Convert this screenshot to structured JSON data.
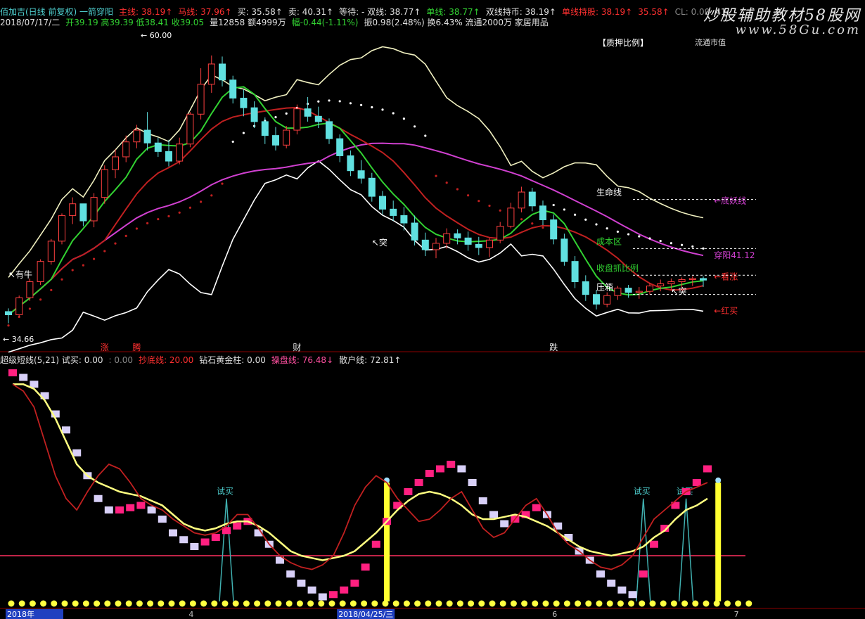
{
  "header": {
    "row1": [
      {
        "t": "佰加吉(日线 前复权) 一箭穿阳",
        "c": "cyan"
      },
      {
        "t": "主线: 38.19↑",
        "c": "red"
      },
      {
        "t": "马线: 37.96↑",
        "c": "red"
      },
      {
        "t": "买: 35.58↑",
        "c": "white"
      },
      {
        "t": "卖: 40.31↑",
        "c": "white"
      },
      {
        "t": "等待: - 双线: 38.77↑",
        "c": "white"
      },
      {
        "t": "单线: 38.77↑",
        "c": "green"
      },
      {
        "t": "双线持币: 38.19↑",
        "c": "white"
      },
      {
        "t": "单线持股: 38.19↑",
        "c": "red"
      },
      {
        "t": "35.58↑",
        "c": "red"
      },
      {
        "t": "CL: 0.00",
        "c": "gray"
      },
      {
        "t": "41.",
        "c": "white"
      }
    ],
    "row2": [
      {
        "t": "2018/07/17/二",
        "c": "white"
      },
      {
        "t": "开39.19 高39.39 低38.41 收39.05",
        "c": "green"
      },
      {
        "t": "量12858 额4999万",
        "c": "white"
      },
      {
        "t": "幅-0.44(-1.11%)",
        "c": "green"
      },
      {
        "t": "振0.98(2.48%) 换6.43% 流通2000万 家居用品",
        "c": "white"
      }
    ],
    "row3": [
      {
        "t": "超级短线(5,21) 试买: 0.00",
        "c": "white"
      },
      {
        "t": ": 0.00",
        "c": "gray"
      },
      {
        "t": "抄底线: 20.00",
        "c": "red"
      },
      {
        "t": "钻石黄金柱: 0.00",
        "c": "white"
      },
      {
        "t": "操盘线: 76.48↓",
        "c": "pink"
      },
      {
        "t": "散户线: 72.81↑",
        "c": "white"
      }
    ],
    "tab_label": "【质押比例】",
    "watermark1": "炒股辅助教材58股网",
    "watermark2": "www.58Gu.com",
    "top_right_text": "流通市值"
  },
  "chart_data": [
    {
      "type": "candlestick",
      "title": "佰加吉(日线 前复权) 一箭穿阳",
      "ylim": [
        33,
        62
      ],
      "x_count": 66,
      "candles": [
        [
          36.1,
          36.4,
          35.0,
          35.8
        ],
        [
          35.8,
          37.6,
          35.6,
          37.4
        ],
        [
          37.4,
          39.2,
          37.1,
          38.9
        ],
        [
          38.9,
          41.0,
          38.6,
          40.8
        ],
        [
          40.8,
          42.9,
          40.5,
          42.7
        ],
        [
          42.7,
          45.3,
          42.4,
          45.1
        ],
        [
          45.1,
          46.8,
          44.3,
          46.2
        ],
        [
          46.2,
          45.9,
          44.1,
          44.6
        ],
        [
          44.6,
          47.2,
          44.0,
          46.8
        ],
        [
          46.8,
          49.8,
          46.2,
          49.4
        ],
        [
          49.4,
          51.3,
          48.6,
          50.6
        ],
        [
          50.6,
          52.6,
          50.1,
          52.0
        ],
        [
          52.0,
          53.6,
          51.4,
          53.1
        ],
        [
          53.1,
          54.8,
          51.2,
          51.9
        ],
        [
          51.9,
          52.4,
          50.6,
          51.1
        ],
        [
          51.1,
          52.2,
          49.7,
          50.2
        ],
        [
          50.2,
          52.4,
          49.9,
          51.8
        ],
        [
          51.8,
          54.8,
          51.5,
          54.6
        ],
        [
          54.6,
          58.9,
          54.1,
          57.4
        ],
        [
          57.4,
          60.1,
          56.6,
          59.3
        ],
        [
          59.3,
          60.0,
          57.2,
          57.8
        ],
        [
          57.8,
          58.2,
          55.6,
          56.1
        ],
        [
          56.1,
          56.9,
          54.4,
          55.2
        ],
        [
          55.2,
          55.8,
          53.3,
          53.9
        ],
        [
          53.9,
          54.3,
          51.8,
          52.6
        ],
        [
          52.6,
          53.4,
          51.2,
          51.7
        ],
        [
          51.7,
          53.5,
          51.4,
          53.1
        ],
        [
          53.1,
          55.5,
          52.7,
          55.1
        ],
        [
          55.1,
          56.2,
          53.9,
          54.4
        ],
        [
          54.4,
          55.3,
          53.3,
          53.9
        ],
        [
          53.9,
          54.2,
          51.8,
          52.3
        ],
        [
          52.3,
          52.7,
          50.1,
          50.7
        ],
        [
          50.7,
          51.2,
          48.8,
          49.3
        ],
        [
          49.3,
          50.3,
          48.1,
          48.6
        ],
        [
          48.6,
          49.1,
          46.4,
          46.9
        ],
        [
          46.9,
          47.4,
          45.2,
          45.7
        ],
        [
          45.7,
          46.5,
          44.6,
          45.1
        ],
        [
          45.1,
          45.9,
          43.7,
          44.4
        ],
        [
          44.4,
          45.1,
          42.3,
          42.8
        ],
        [
          42.8,
          43.5,
          41.3,
          41.9
        ],
        [
          41.9,
          43.0,
          41.1,
          42.5
        ],
        [
          42.5,
          43.9,
          42.0,
          43.4
        ],
        [
          43.4,
          43.8,
          42.4,
          43.0
        ],
        [
          43.0,
          43.6,
          41.8,
          42.4
        ],
        [
          42.4,
          43.1,
          41.4,
          42.1
        ],
        [
          42.1,
          43.0,
          41.2,
          42.8
        ],
        [
          42.8,
          44.5,
          42.5,
          44.1
        ],
        [
          44.1,
          46.3,
          43.9,
          45.8
        ],
        [
          45.8,
          47.8,
          45.4,
          47.3
        ],
        [
          47.3,
          47.7,
          45.5,
          46.0
        ],
        [
          46.0,
          46.5,
          44.2,
          44.7
        ],
        [
          44.7,
          45.2,
          42.4,
          42.9
        ],
        [
          42.9,
          43.4,
          40.4,
          40.8
        ],
        [
          40.8,
          41.3,
          38.3,
          38.9
        ],
        [
          38.9,
          39.5,
          37.1,
          37.7
        ],
        [
          37.7,
          38.1,
          36.3,
          36.8
        ],
        [
          36.8,
          37.9,
          36.5,
          37.6
        ],
        [
          37.6,
          38.5,
          37.2,
          38.3
        ],
        [
          38.3,
          38.6,
          37.4,
          37.9
        ],
        [
          37.9,
          38.4,
          37.3,
          38.0
        ],
        [
          38.0,
          38.8,
          37.7,
          38.5
        ],
        [
          38.5,
          39.1,
          38.0,
          38.7
        ],
        [
          38.7,
          39.2,
          38.1,
          38.9
        ],
        [
          38.9,
          39.3,
          38.3,
          39.1
        ],
        [
          39.1,
          39.4,
          38.5,
          39.2
        ],
        [
          39.2,
          39.39,
          38.41,
          39.05
        ]
      ],
      "price_labels": {
        "high": "60.00",
        "low": "34.66"
      },
      "annotations": [
        {
          "label": "生命线",
          "color": "#ffffff",
          "i": 55,
          "y": 47.0
        },
        {
          "label": "成本区",
          "color": "#32d232",
          "i": 55,
          "y": 42.4
        },
        {
          "label": "收盘抓比例",
          "color": "#32d232",
          "i": 55,
          "y": 39.9
        },
        {
          "label": "压箱",
          "color": "#ffffff",
          "i": 55,
          "y": 38.1
        },
        {
          "label": "↖突",
          "color": "#ffffff",
          "i": 34,
          "y": 42.3
        },
        {
          "label": "↖突",
          "color": "#ffffff",
          "i": 62,
          "y": 37.7
        },
        {
          "label": "↖有牛",
          "color": "#ffffff",
          "i": 0,
          "y": 39.3
        },
        {
          "label": "←底妖线",
          "color": "#d040d0",
          "i": 66,
          "y": 46.2
        },
        {
          "label": "穿阳41.12",
          "color": "#d040d0",
          "i": 66,
          "y": 41.12
        },
        {
          "label": "←看涨",
          "color": "#ff3030",
          "i": 66,
          "y": 39.1
        },
        {
          "label": "←红买",
          "color": "#ff3030",
          "i": 66,
          "y": 35.9
        }
      ],
      "bottom_marks": [
        {
          "label": "涨",
          "color": "#ff3030",
          "i": 9
        },
        {
          "label": "腾",
          "color": "#ff3030",
          "i": 12
        },
        {
          "label": "财",
          "color": "#e8e8e8",
          "i": 27
        },
        {
          "label": "跌",
          "color": "#e8e8e8",
          "i": 51
        }
      ]
    },
    {
      "type": "line",
      "title": "超级短线(5,21)",
      "ylim": [
        0,
        100
      ],
      "baseline": 20,
      "series": [
        {
          "name": "操盘线",
          "color": "#ff2080",
          "style": "blocks",
          "values": [
            100,
            98,
            95,
            90,
            82,
            75,
            65,
            55,
            45,
            40,
            40,
            41,
            42,
            40,
            36,
            30,
            27,
            24,
            26,
            28,
            31,
            33,
            35,
            30,
            25,
            18,
            12,
            8,
            5,
            2,
            3,
            5,
            8,
            15,
            25,
            35,
            42,
            48,
            52,
            56,
            58,
            60,
            58,
            52,
            44,
            38,
            34,
            36,
            38,
            41,
            38,
            33,
            28,
            22,
            18,
            12,
            8,
            5,
            3,
            12,
            25,
            32,
            42,
            48,
            52,
            58
          ]
        },
        {
          "name": "散户线",
          "color": "#ffff80",
          "values": [
            95,
            95,
            93,
            88,
            80,
            70,
            60,
            55,
            52,
            50,
            48,
            47,
            46,
            44,
            42,
            38,
            34,
            32,
            31,
            32,
            34,
            35,
            35,
            33,
            30,
            26,
            22,
            20,
            19,
            18,
            19,
            20,
            22,
            26,
            30,
            35,
            40,
            44,
            47,
            48,
            47,
            45,
            42,
            38,
            36,
            36,
            37,
            38,
            37,
            35,
            33,
            30,
            27,
            24,
            22,
            21,
            20,
            21,
            22,
            24,
            28,
            31,
            36,
            40,
            42,
            45
          ]
        },
        {
          "name": "红线",
          "color": "#c02020",
          "values": [
            95,
            92,
            85,
            70,
            55,
            45,
            40,
            48,
            55,
            60,
            58,
            52,
            45,
            42,
            40,
            36,
            33,
            30,
            29,
            30,
            33,
            38,
            38,
            32,
            25,
            20,
            17,
            15,
            14,
            16,
            20,
            30,
            42,
            50,
            55,
            52,
            45,
            40,
            35,
            36,
            40,
            45,
            48,
            40,
            32,
            28,
            30,
            36,
            42,
            45,
            38,
            30,
            25,
            22,
            18,
            15,
            14,
            16,
            20,
            28,
            36,
            40,
            44,
            48,
            50,
            52
          ]
        }
      ],
      "trial_buy": [
        20,
        59,
        63
      ],
      "gold_pillars": [
        35,
        66
      ],
      "markers": [
        {
          "label": "试买",
          "color": "#4fd0d0",
          "i": 20
        },
        {
          "label": "试买",
          "color": "#4fd0d0",
          "i": 59
        },
        {
          "label": "试买",
          "color": "#4fd0d0",
          "i": 63
        }
      ],
      "x_ticks": [
        {
          "label": "2018年",
          "i": 0
        },
        {
          "label": "4",
          "i": 17
        },
        {
          "label": "2018/04/25/三",
          "i": 31
        },
        {
          "label": "6",
          "i": 51
        },
        {
          "label": "7",
          "i": 68
        }
      ]
    }
  ]
}
